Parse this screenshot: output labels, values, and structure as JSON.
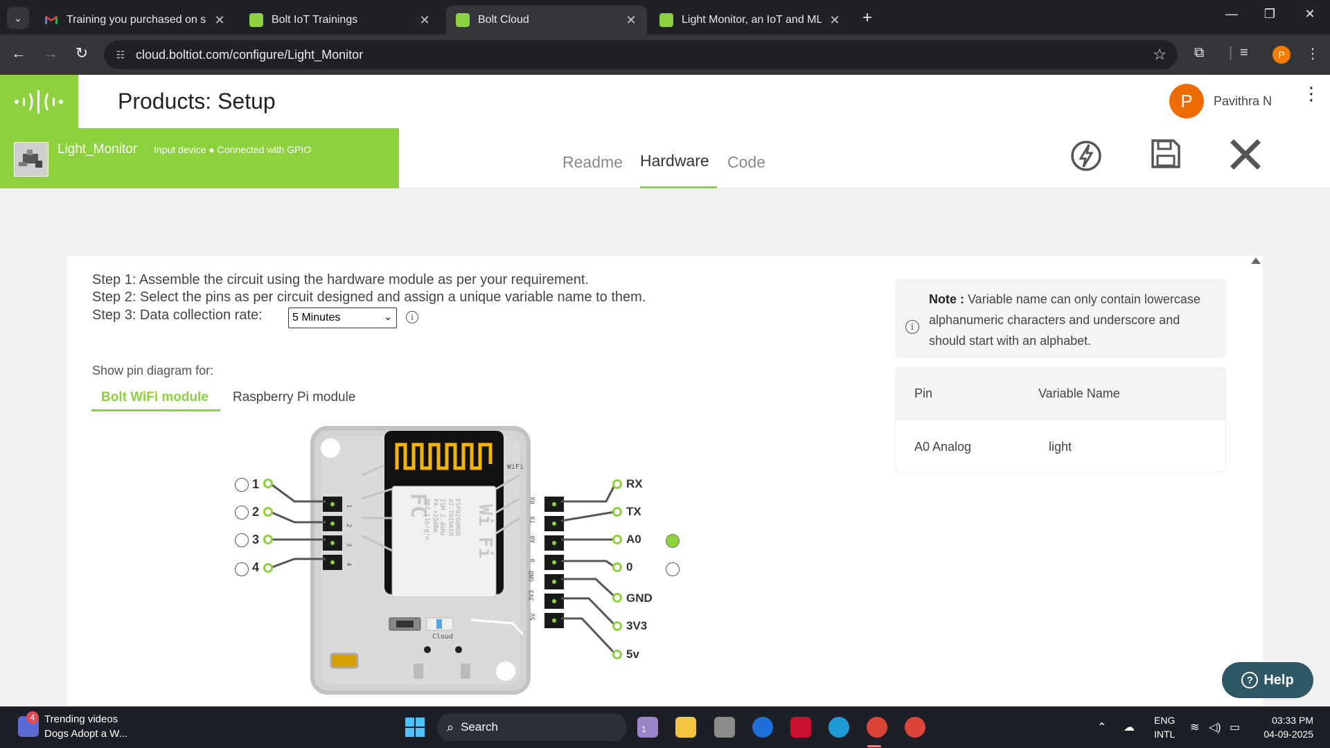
{
  "browser": {
    "tabs": [
      {
        "title": "Training you purchased on shop",
        "favicon_color": "#ea4335"
      },
      {
        "title": "Bolt IoT Trainings",
        "favicon_color": "#8dd13f"
      },
      {
        "title": "Bolt Cloud",
        "favicon_color": "#8dd13f"
      },
      {
        "title": "Light Monitor, an IoT and ML proj",
        "favicon_color": "#8dd13f"
      }
    ],
    "url": "cloud.boltiot.com/configure/Light_Monitor",
    "profile_initial": "P"
  },
  "header": {
    "title": "Products: Setup",
    "user_initial": "P",
    "user_name": "Pavithra N"
  },
  "product": {
    "name": "Light_Monitor",
    "meta": "Input device ● Connected with GPIO",
    "tabs": [
      "Readme",
      "Hardware",
      "Code"
    ],
    "active_tab": "Hardware"
  },
  "steps": {
    "step1": "Step 1: Assemble the circuit using the hardware module as per your requirement.",
    "step2": "Step 2: Select the pins as per circuit designed and assign a unique variable name to them.",
    "step3": "Step 3: Data collection rate:",
    "rate_value": "5 Minutes"
  },
  "pin_diagram": {
    "label": "Show pin diagram for:",
    "modules": [
      "Bolt WiFi module",
      "Raspberry Pi module"
    ],
    "active_module": "Bolt WiFi module",
    "left_pins": [
      "1",
      "2",
      "3",
      "4"
    ],
    "right_pins": [
      "RX",
      "TX",
      "A0",
      "0",
      "GND",
      "3V3",
      "5v"
    ],
    "selected_pin": "A0",
    "board_text": {
      "wifi": "WiFi",
      "cloud": "Cloud",
      "chip_brand": "Wi Fi",
      "chip_model": "ESP8266MOD",
      "chip_vendor": "AI-THINKER",
      "chip_ism": "ISM 2.4GHz",
      "chip_pa": "PA +25dBm",
      "chip_std": "802.11b/g/n",
      "chip_fc": "FC",
      "header_pins": [
        "1",
        "2",
        "3",
        "4",
        "RX",
        "TX",
        "A0",
        "0",
        "GND",
        "3V3",
        "5V"
      ]
    }
  },
  "note": {
    "label": "Note :",
    "text": "Variable name can only contain lowercase alphanumeric characters and underscore and should start with an alphabet."
  },
  "pin_table": {
    "headers": [
      "Pin",
      "Variable Name"
    ],
    "rows": [
      [
        "A0 Analog",
        "light"
      ]
    ]
  },
  "help": {
    "label": "Help"
  },
  "taskbar": {
    "news_badge": "4",
    "news_title": "Trending videos",
    "news_sub": "Dogs Adopt a W...",
    "search": "Search",
    "lang1": "ENG",
    "lang2": "INTL",
    "time": "03:33 PM",
    "date": "04-09-2025",
    "app_badge": "1"
  }
}
